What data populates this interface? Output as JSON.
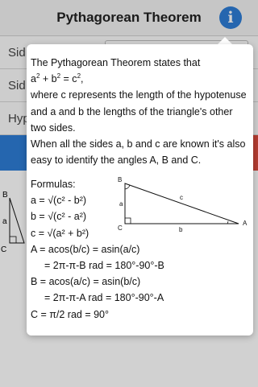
{
  "header": {
    "title": "Pythagorean Theorem",
    "info_icon": "i"
  },
  "rows": [
    {
      "label": "Sid"
    },
    {
      "label": "Sid"
    },
    {
      "label": "Hyp"
    }
  ],
  "background_triangle": {
    "labels": {
      "b": "B",
      "a": "a",
      "c": "C"
    }
  },
  "popup": {
    "intro1": "The Pythagorean Theorem states that",
    "eq_a": "a",
    "eq_plus": " + b",
    "eq_eq": " = c",
    "eq_end": ",",
    "sup2": "2",
    "intro2": "where c represents the length of the hypotenuse and a and b the lengths of the triangle's other two sides.",
    "intro3": "When all the sides a, b and c are known it's also easy to identify the angles A, B and C.",
    "formulas_title": "Formulas:",
    "f_a": "a = √(c² - b²)",
    "f_b": "b = √(c² - a²)",
    "f_c": "c = √(a² + b²)",
    "f_A1": "A = acos(b/c) = asin(a/c)",
    "f_A2": "= 2π-π-B rad = 180°-90°-B",
    "f_B1": "B = acos(a/c) = asin(b/c)",
    "f_B2": "= 2π-π-A rad = 180°-90°-A",
    "f_C": "C = π/2 rad = 90°",
    "diagram_labels": {
      "B": "B",
      "C": "C",
      "A": "A",
      "a": "a",
      "b": "b",
      "c": "c"
    }
  }
}
